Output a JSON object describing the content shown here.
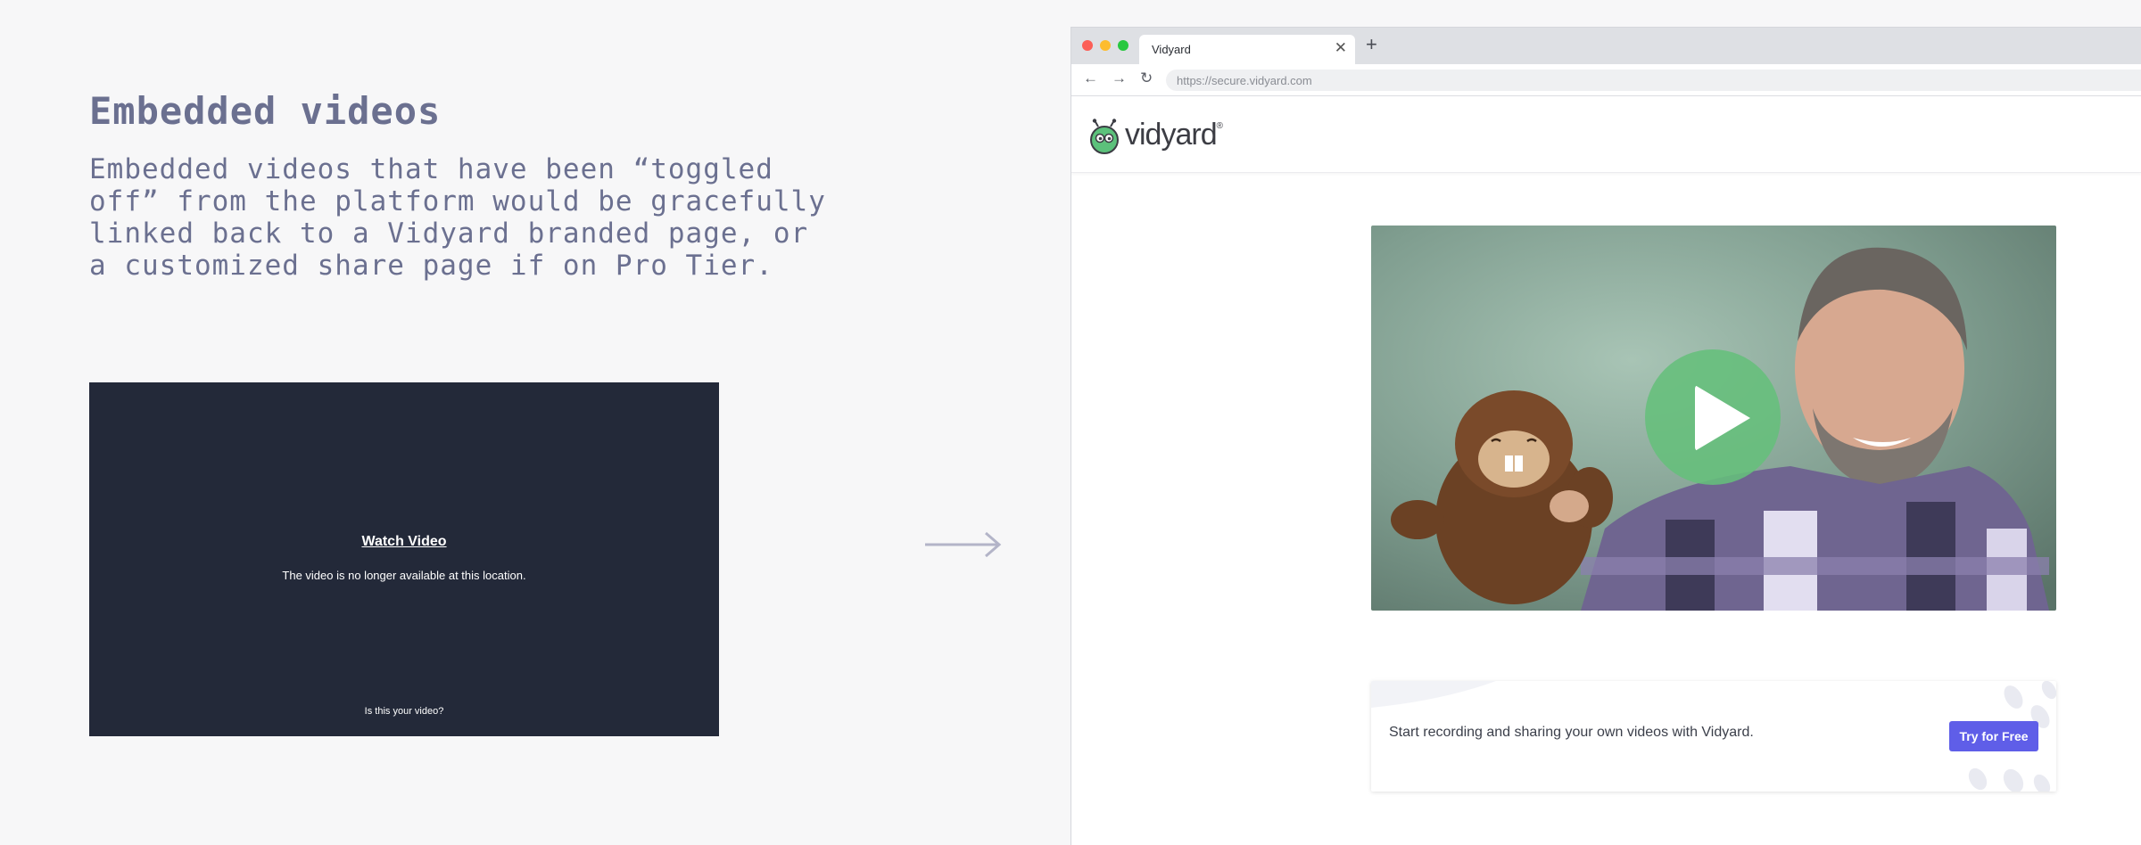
{
  "slide": {
    "title": "Embedded videos",
    "description": "Embedded videos that have been “toggled off” from the platform would be gracefully linked back to a Vidyard branded page, or a customized share page if on Pro Tier."
  },
  "embed": {
    "watch_link": "Watch Video",
    "message": "The video is no longer available at this location.",
    "owner_link": "Is this your video?"
  },
  "browser": {
    "tab_title": "Vidyard",
    "tab_close_icon": "✕",
    "new_tab_icon": "+",
    "back_icon": "←",
    "forward_icon": "→",
    "reload_icon": "↻",
    "url": "https://secure.vidyard.com"
  },
  "site": {
    "logo_text": "vidyard",
    "logo_reg": "®",
    "promo_text": "Start recording and sharing your own videos with Vidyard.",
    "promo_button": "Try for Free"
  },
  "colors": {
    "accent": "#5f5ee8",
    "play_button": "#65bf7b",
    "embed_bg": "#232939",
    "heading": "#6b7090"
  }
}
